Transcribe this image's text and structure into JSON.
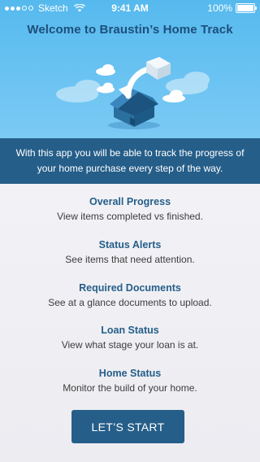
{
  "status_bar": {
    "carrier": "Sketch",
    "time": "9:41 AM",
    "battery": "100%"
  },
  "hero": {
    "title": "Welcome to Braustin’s Home Track",
    "illustration": "house-with-arrow-icon"
  },
  "intro": {
    "text": "With this app you will be able to track the progress of your home purchase every step of the way."
  },
  "features": [
    {
      "title": "Overall Progress",
      "description": "View items completed vs finished."
    },
    {
      "title": "Status Alerts",
      "description": "See items that need attention."
    },
    {
      "title": "Required Documents",
      "description": "See at a glance documents to upload."
    },
    {
      "title": "Loan Status",
      "description": "View what stage your loan is at."
    },
    {
      "title": "Home Status",
      "description": "Monitor the build of your home."
    }
  ],
  "cta": {
    "label": "LET’S START"
  },
  "colors": {
    "primary": "#255e89",
    "hero_bg": "#66c1f1",
    "list_bg": "#efeff3"
  }
}
